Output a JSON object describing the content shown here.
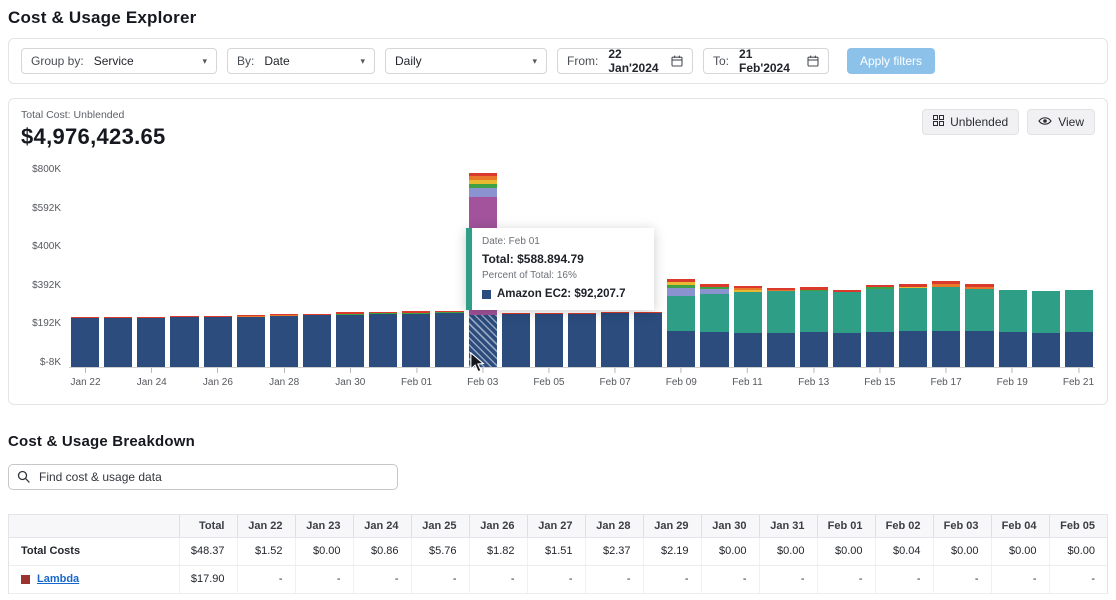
{
  "header": {
    "title": "Cost & Usage Explorer"
  },
  "filters": {
    "group_by_label": "Group by:",
    "group_by_value": "Service",
    "by_label": "By:",
    "by_value": "Date",
    "granularity_value": "Daily",
    "from_label": "From:",
    "from_value": "22 Jan'2024",
    "to_label": "To:",
    "to_value": "21 Feb'2024",
    "apply_button": "Apply filters"
  },
  "chart_card": {
    "total_label": "Total Cost: Unblended",
    "total_value": "$4,976,423.65",
    "unblended_button": "Unblended",
    "view_button": "View",
    "tooltip": {
      "date": "Date: Feb 01",
      "total": "Total: $588.894.79",
      "percent": "Percent of Total: 16%",
      "item": "Amazon EC2: $92,207.7",
      "item_color": "#2b4c7d",
      "accent_color": "#319e87"
    }
  },
  "chart_data": {
    "type": "bar",
    "stacked": true,
    "unit": "$K",
    "y_axis_max_k": 800,
    "y_ticks": [
      "$800K",
      "$592K",
      "$400K",
      "$392K",
      "$192K",
      "$-8K"
    ],
    "x_tick_dates": [
      "Jan 22",
      "Jan 24",
      "Jan 26",
      "Jan 28",
      "Jan 30",
      "Feb 01",
      "Feb 03",
      "Feb 05",
      "Feb 07",
      "Feb 09",
      "Feb 11",
      "Feb 13",
      "Feb 15",
      "Feb 17",
      "Feb 19",
      "Feb 21"
    ],
    "colors": {
      "ec2": "#2b4c7d",
      "teal": "#2f9e86",
      "purple": "#a2539b",
      "lavender": "#8a93cf",
      "green": "#3fa045",
      "yellow": "#e9b92f",
      "orange": "#e8792a",
      "red": "#d93a2b"
    },
    "bars": [
      {
        "date": "Jan 22",
        "segments": [
          {
            "c": "ec2",
            "v": 192
          },
          {
            "c": "red",
            "v": 4
          }
        ]
      },
      {
        "date": "Jan 23",
        "segments": [
          {
            "c": "ec2",
            "v": 194
          },
          {
            "c": "red",
            "v": 4
          }
        ]
      },
      {
        "date": "Jan 24",
        "segments": [
          {
            "c": "ec2",
            "v": 194
          },
          {
            "c": "red",
            "v": 4
          }
        ]
      },
      {
        "date": "Jan 25",
        "segments": [
          {
            "c": "ec2",
            "v": 196
          },
          {
            "c": "red",
            "v": 4
          }
        ]
      },
      {
        "date": "Jan 26",
        "segments": [
          {
            "c": "ec2",
            "v": 198
          },
          {
            "c": "red",
            "v": 5
          }
        ]
      },
      {
        "date": "Jan 27",
        "segments": [
          {
            "c": "ec2",
            "v": 200
          },
          {
            "c": "orange",
            "v": 3
          },
          {
            "c": "red",
            "v": 4
          }
        ]
      },
      {
        "date": "Jan 28",
        "segments": [
          {
            "c": "ec2",
            "v": 202
          },
          {
            "c": "orange",
            "v": 3
          },
          {
            "c": "red",
            "v": 4
          }
        ]
      },
      {
        "date": "Jan 29",
        "segments": [
          {
            "c": "ec2",
            "v": 204
          },
          {
            "c": "red",
            "v": 5
          }
        ]
      },
      {
        "date": "Jan 30",
        "segments": [
          {
            "c": "ec2",
            "v": 206
          },
          {
            "c": "green",
            "v": 4
          },
          {
            "c": "red",
            "v": 5
          }
        ]
      },
      {
        "date": "Jan 31",
        "segments": [
          {
            "c": "ec2",
            "v": 208
          },
          {
            "c": "green",
            "v": 4
          },
          {
            "c": "red",
            "v": 5
          }
        ]
      },
      {
        "date": "Feb 01",
        "segments": [
          {
            "c": "ec2",
            "v": 210
          },
          {
            "c": "green",
            "v": 4
          },
          {
            "c": "red",
            "v": 5
          }
        ]
      },
      {
        "date": "Feb 02",
        "segments": [
          {
            "c": "ec2",
            "v": 212
          },
          {
            "c": "green",
            "v": 4
          },
          {
            "c": "red",
            "v": 4
          }
        ]
      },
      {
        "date": "Feb 03",
        "hovered": true,
        "segments": [
          {
            "c": "ec2",
            "v": 205
          },
          {
            "c": "purple",
            "v": 465
          },
          {
            "c": "lavender",
            "v": 35
          },
          {
            "c": "green",
            "v": 18
          },
          {
            "c": "yellow",
            "v": 15
          },
          {
            "c": "orange",
            "v": 14
          },
          {
            "c": "red",
            "v": 14
          }
        ]
      },
      {
        "date": "Feb 04",
        "segments": [
          {
            "c": "ec2",
            "v": 210
          },
          {
            "c": "red",
            "v": 4
          }
        ]
      },
      {
        "date": "Feb 05",
        "segments": [
          {
            "c": "ec2",
            "v": 208
          },
          {
            "c": "red",
            "v": 4
          }
        ]
      },
      {
        "date": "Feb 06",
        "segments": [
          {
            "c": "ec2",
            "v": 210
          },
          {
            "c": "red",
            "v": 4
          }
        ]
      },
      {
        "date": "Feb 07",
        "segments": [
          {
            "c": "ec2",
            "v": 212
          },
          {
            "c": "red",
            "v": 4
          }
        ]
      },
      {
        "date": "Feb 08",
        "segments": [
          {
            "c": "ec2",
            "v": 214
          },
          {
            "c": "red",
            "v": 4
          }
        ]
      },
      {
        "date": "Feb 09",
        "segments": [
          {
            "c": "ec2",
            "v": 140
          },
          {
            "c": "teal",
            "v": 140
          },
          {
            "c": "lavender",
            "v": 30
          },
          {
            "c": "green",
            "v": 14
          },
          {
            "c": "yellow",
            "v": 10
          },
          {
            "c": "red",
            "v": 14
          }
        ]
      },
      {
        "date": "Feb 10",
        "segments": [
          {
            "c": "ec2",
            "v": 138
          },
          {
            "c": "teal",
            "v": 150
          },
          {
            "c": "lavender",
            "v": 18
          },
          {
            "c": "green",
            "v": 8
          },
          {
            "c": "red",
            "v": 12
          }
        ]
      },
      {
        "date": "Feb 11",
        "segments": [
          {
            "c": "ec2",
            "v": 136
          },
          {
            "c": "teal",
            "v": 160
          },
          {
            "c": "yellow",
            "v": 8
          },
          {
            "c": "orange",
            "v": 6
          },
          {
            "c": "red",
            "v": 8
          }
        ]
      },
      {
        "date": "Feb 12",
        "segments": [
          {
            "c": "ec2",
            "v": 136
          },
          {
            "c": "teal",
            "v": 162
          },
          {
            "c": "orange",
            "v": 6
          },
          {
            "c": "red",
            "v": 8
          }
        ]
      },
      {
        "date": "Feb 13",
        "segments": [
          {
            "c": "ec2",
            "v": 138
          },
          {
            "c": "teal",
            "v": 160
          },
          {
            "c": "green",
            "v": 6
          },
          {
            "c": "red",
            "v": 10
          }
        ]
      },
      {
        "date": "Feb 14",
        "segments": [
          {
            "c": "ec2",
            "v": 136
          },
          {
            "c": "teal",
            "v": 158
          },
          {
            "c": "red",
            "v": 10
          }
        ]
      },
      {
        "date": "Feb 15",
        "segments": [
          {
            "c": "ec2",
            "v": 138
          },
          {
            "c": "teal",
            "v": 168
          },
          {
            "c": "green",
            "v": 8
          },
          {
            "c": "red",
            "v": 10
          }
        ]
      },
      {
        "date": "Feb 16",
        "segments": [
          {
            "c": "ec2",
            "v": 140
          },
          {
            "c": "teal",
            "v": 170
          },
          {
            "c": "yellow",
            "v": 6
          },
          {
            "c": "red",
            "v": 12
          }
        ]
      },
      {
        "date": "Feb 17",
        "segments": [
          {
            "c": "ec2",
            "v": 142
          },
          {
            "c": "teal",
            "v": 172
          },
          {
            "c": "orange",
            "v": 12
          },
          {
            "c": "red",
            "v": 14
          }
        ]
      },
      {
        "date": "Feb 18",
        "segments": [
          {
            "c": "ec2",
            "v": 140
          },
          {
            "c": "teal",
            "v": 168
          },
          {
            "c": "orange",
            "v": 8
          },
          {
            "c": "red",
            "v": 10
          }
        ]
      },
      {
        "date": "Feb 19",
        "segments": [
          {
            "c": "ec2",
            "v": 138
          },
          {
            "c": "teal",
            "v": 164
          }
        ]
      },
      {
        "date": "Feb 20",
        "segments": [
          {
            "c": "ec2",
            "v": 136
          },
          {
            "c": "teal",
            "v": 162
          }
        ]
      },
      {
        "date": "Feb 21",
        "segments": [
          {
            "c": "ec2",
            "v": 138
          },
          {
            "c": "teal",
            "v": 164
          }
        ]
      }
    ]
  },
  "breakdown": {
    "title": "Cost & Usage Breakdown",
    "search_placeholder": "Find cost & usage data",
    "table": {
      "columns": [
        "",
        "Total",
        "Jan 22",
        "Jan 23",
        "Jan 24",
        "Jan 25",
        "Jan 26",
        "Jan 27",
        "Jan 28",
        "Jan 29",
        "Jan 30",
        "Jan 31",
        "Feb 01",
        "Feb 02",
        "Feb 03",
        "Feb 04",
        "Feb 05"
      ],
      "rows": [
        {
          "label": "Total Costs",
          "style": "bold",
          "values": [
            "$48.37",
            "$1.52",
            "$0.00",
            "$0.86",
            "$5.76",
            "$1.82",
            "$1.51",
            "$2.37",
            "$2.19",
            "$0.00",
            "$0.00",
            "$0.00",
            "$0.04",
            "$0.00",
            "$0.00",
            "$0.00"
          ]
        },
        {
          "label": "Lambda",
          "style": "link",
          "swatch": "#9b3330",
          "values": [
            "$17.90",
            "-",
            "-",
            "-",
            "-",
            "-",
            "-",
            "-",
            "-",
            "-",
            "-",
            "-",
            "-",
            "-",
            "-",
            "-"
          ]
        }
      ]
    }
  }
}
